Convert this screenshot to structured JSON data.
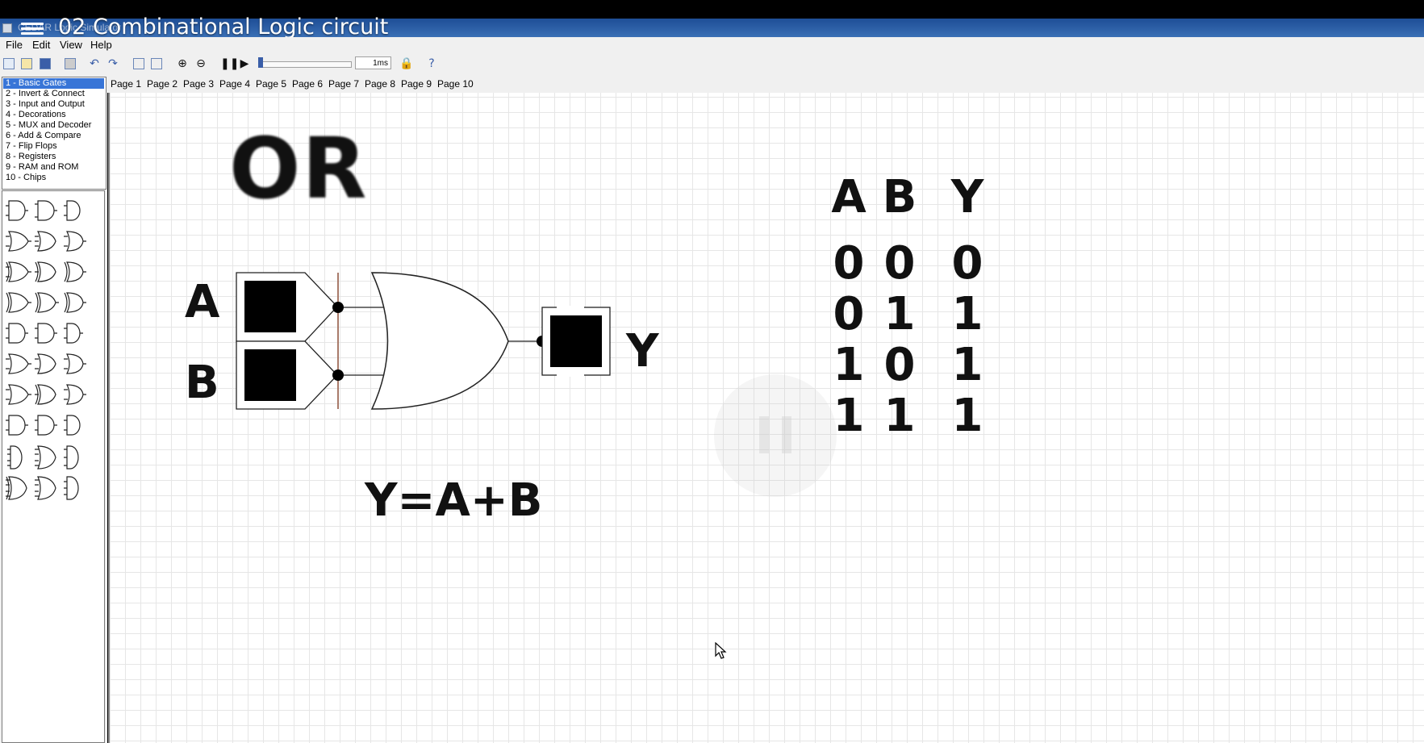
{
  "video_title": "02 Combinational Logic circuit",
  "app_title": "CEDAR Logic Simulator",
  "menu": [
    "File",
    "Edit",
    "View",
    "Help"
  ],
  "toolbar": {
    "icons": [
      "new-icon",
      "open-icon",
      "save-icon",
      "print-icon",
      "undo-icon",
      "redo-icon",
      "copy-icon",
      "paste-icon",
      "zoom-in-icon",
      "zoom-out-icon",
      "pause-icon",
      "step-icon",
      "lock-icon",
      "help-icon"
    ],
    "speed_value": "1ms"
  },
  "tabs": [
    "Page 1",
    "Page 2",
    "Page 3",
    "Page 4",
    "Page 5",
    "Page 6",
    "Page 7",
    "Page 8",
    "Page 9",
    "Page 10"
  ],
  "categories": [
    "1  - Basic Gates",
    "2  - Invert & Connect",
    "3  - Input and Output",
    "4  - Decorations",
    "5  - MUX and Decoder",
    "6  - Add & Compare",
    "7  - Flip Flops",
    "8  - Registers",
    "9  - RAM and ROM",
    "10 - Chips"
  ],
  "selected_category": 0,
  "diagram": {
    "title": "OR",
    "input_a": "A",
    "input_b": "B",
    "output": "Y",
    "equation": "Y=A+B"
  },
  "truth_table": {
    "headers": [
      "A",
      "B",
      "Y"
    ],
    "rows": [
      [
        "0",
        "0",
        "0"
      ],
      [
        "0",
        "1",
        "1"
      ],
      [
        "1",
        "0",
        "1"
      ],
      [
        "1",
        "1",
        "1"
      ]
    ]
  }
}
